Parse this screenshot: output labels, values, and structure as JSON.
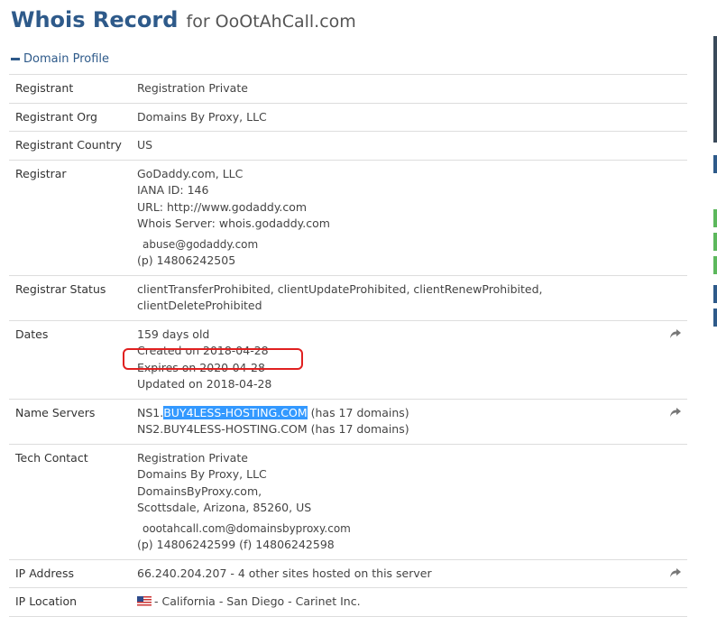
{
  "title": {
    "main": "Whois Record",
    "sub": "for OoOtAhCall.com"
  },
  "section": {
    "label": "Domain Profile"
  },
  "rows": {
    "registrant": {
      "label": "Registrant",
      "value": "Registration Private"
    },
    "registrant_org": {
      "label": "Registrant Org",
      "value": "Domains By Proxy, LLC"
    },
    "registrant_country": {
      "label": "Registrant Country",
      "value": "US"
    },
    "registrar": {
      "label": "Registrar",
      "name": "GoDaddy.com, LLC",
      "iana": "IANA ID: 146",
      "url": "URL: http://www.godaddy.com",
      "whois": "Whois Server: whois.godaddy.com",
      "email": "abuse@godaddy.com",
      "phone": "(p)  14806242505"
    },
    "registrar_status": {
      "label": "Registrar Status",
      "line1": "clientTransferProhibited, clientUpdateProhibited, clientRenewProhibited,",
      "line2": "clientDeleteProhibited"
    },
    "dates": {
      "label": "Dates",
      "age": "159 days old",
      "created": "Created on 2018-04-28",
      "expires": "Expires on 2020-04-28",
      "updated": "Updated on 2018-04-28"
    },
    "name_servers": {
      "label": "Name Servers",
      "ns1_prefix": "NS1.",
      "ns1_host": "BUY4LESS-HOSTING.COM",
      "ns1_suffix": " (has 17 domains)",
      "ns2": "NS2.BUY4LESS-HOSTING.COM (has 17 domains)"
    },
    "tech_contact": {
      "label": "Tech Contact",
      "name": "Registration Private",
      "org": "Domains By Proxy, LLC",
      "company": "DomainsByProxy.com,",
      "location": "Scottsdale, Arizona, 85260, US",
      "email": "oootahcall.com@domainsbyproxy.com",
      "phone": "(p)  14806242599  (f)  14806242598"
    },
    "ip_address": {
      "label": "IP Address",
      "value": "66.240.204.207 - 4 other sites hosted on this server"
    },
    "ip_location": {
      "label": "IP Location",
      "value": "- California - San Diego - Carinet Inc."
    }
  },
  "colors": {
    "accent": "#2e5a8a",
    "highlight": "#3399ff",
    "annotation": "#e02020",
    "green": "#5cb85c"
  }
}
